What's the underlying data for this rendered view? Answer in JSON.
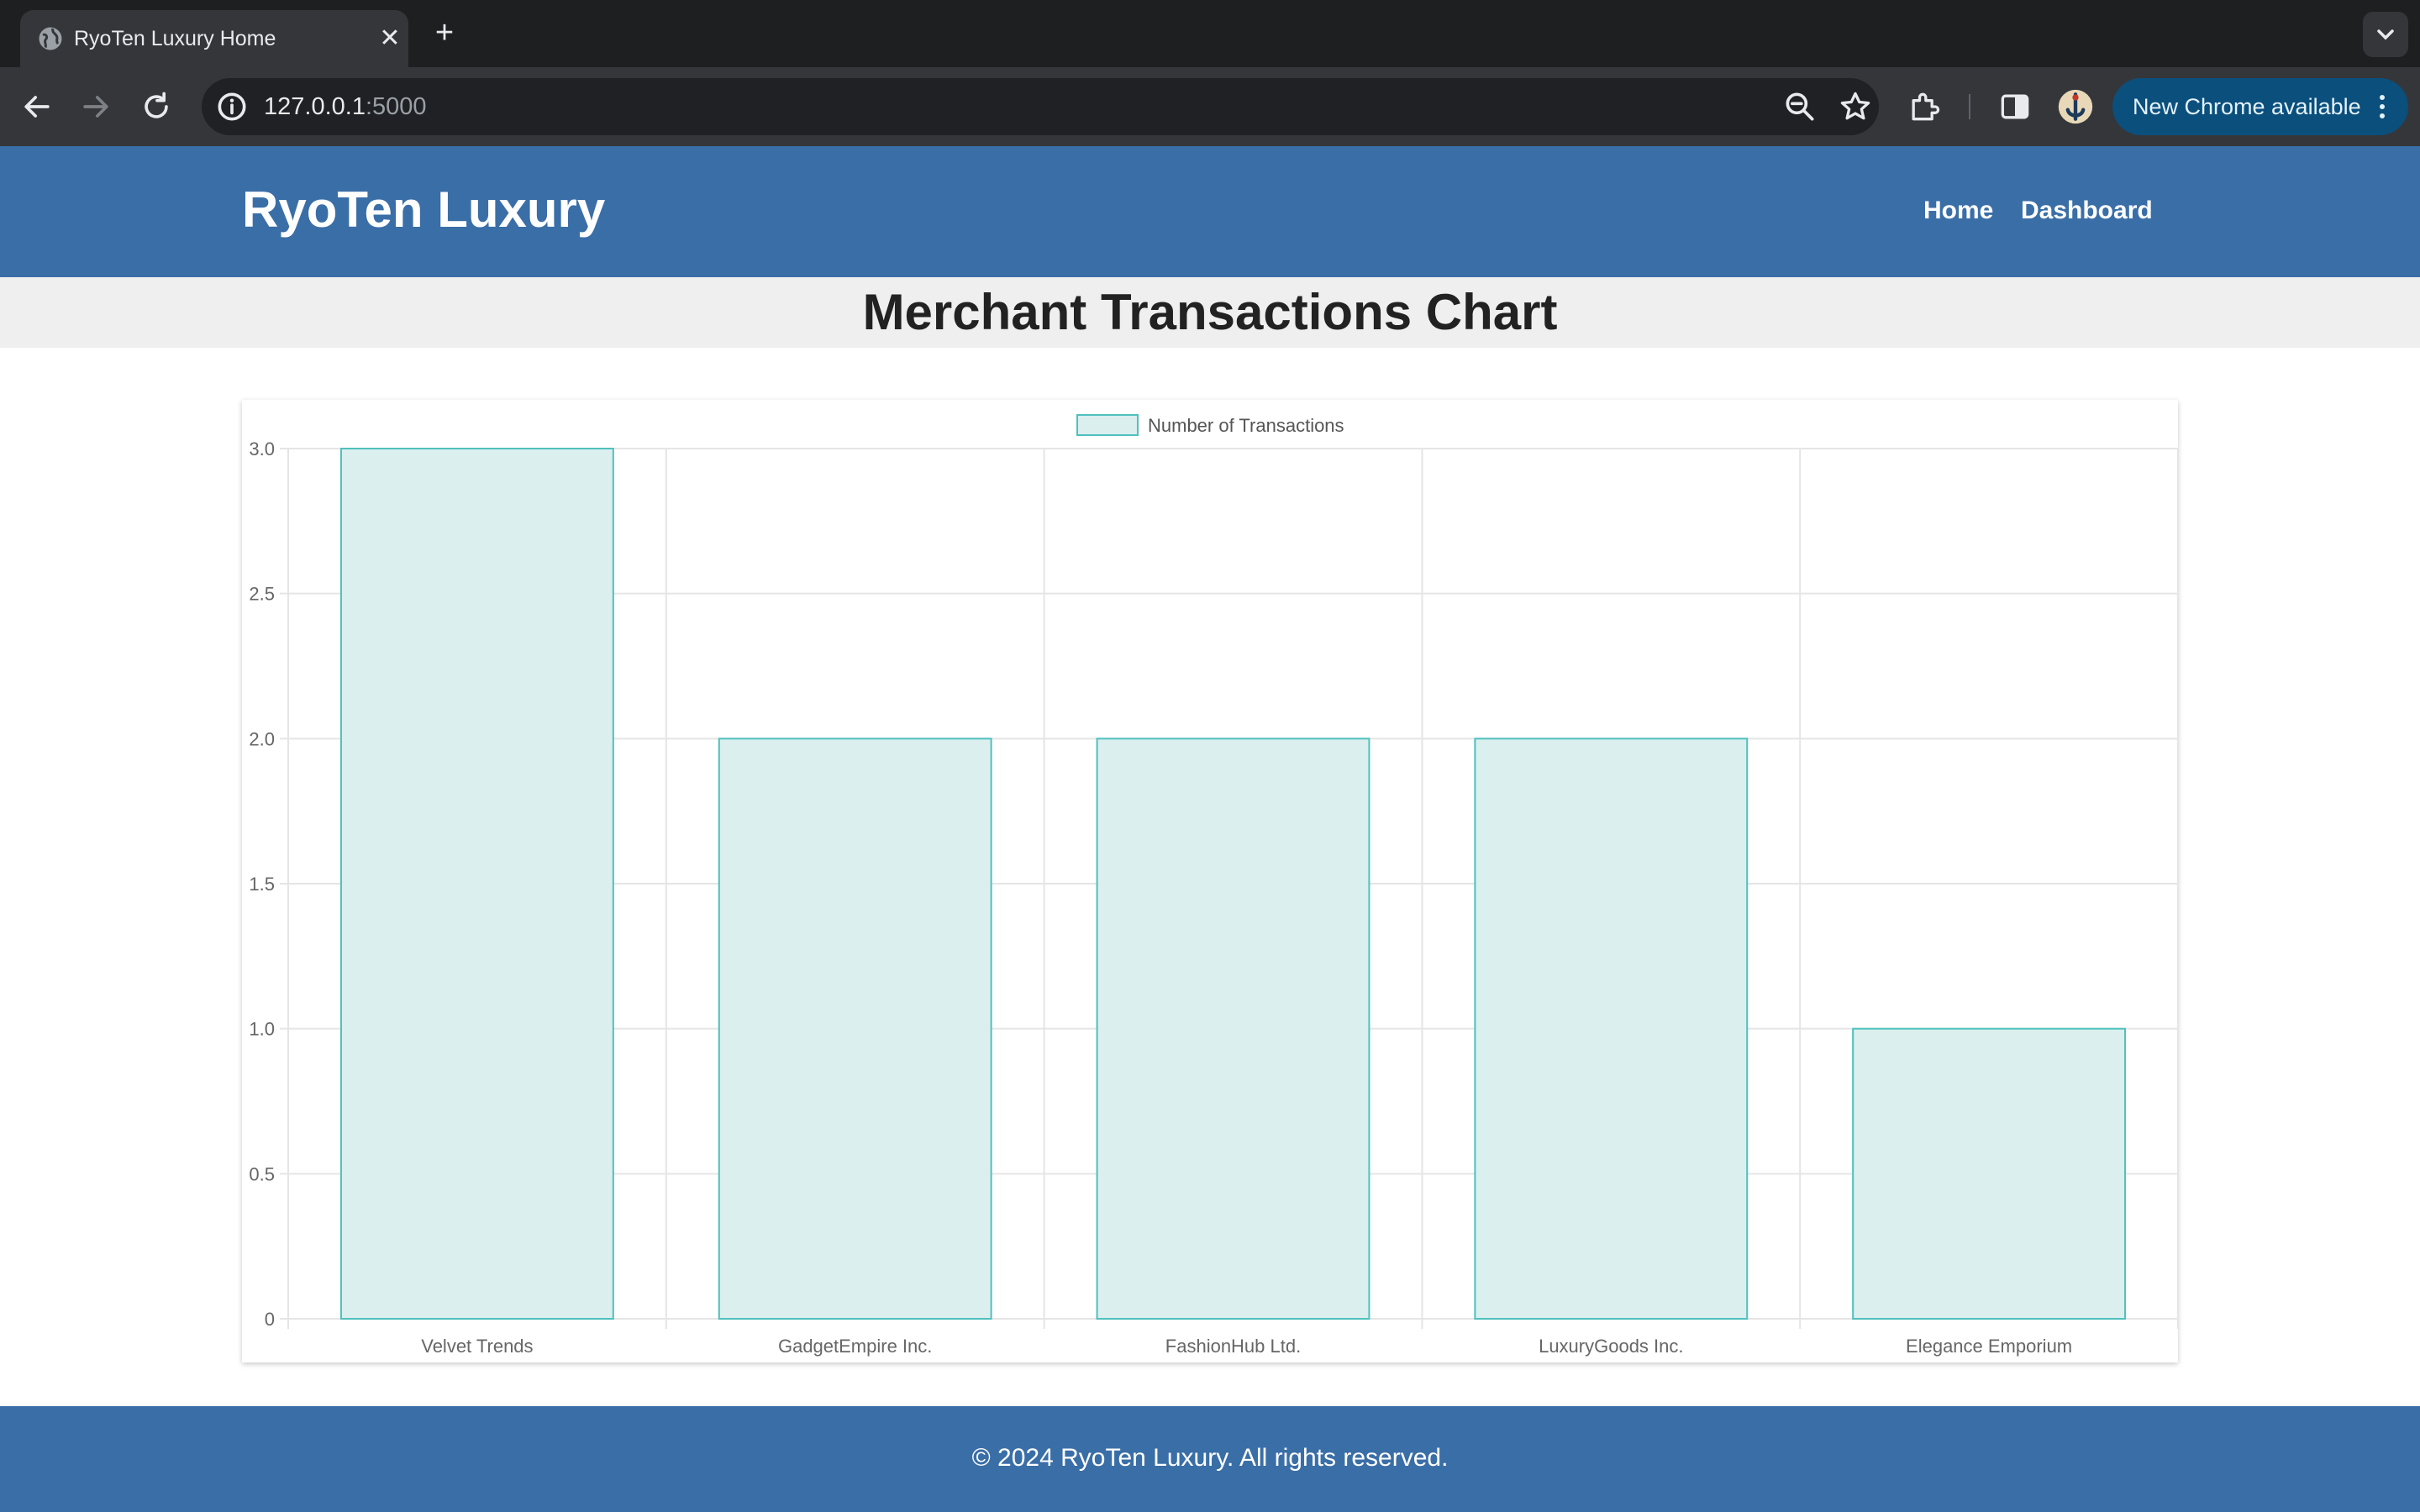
{
  "browser": {
    "tab_title": "RyoTen Luxury Home",
    "url_host": "127.0.0.1",
    "url_port": ":5000",
    "update_label": "New Chrome available",
    "icons": [
      "globe-icon",
      "close-icon",
      "plus-icon",
      "chevron-down-icon",
      "back-arrow-icon",
      "forward-arrow-icon",
      "reload-icon",
      "info-icon",
      "zoom-out-icon",
      "star-icon",
      "extensions-icon",
      "side-panel-icon",
      "profile-avatar",
      "kebab-menu-icon"
    ]
  },
  "header": {
    "brand": "RyoTen Luxury",
    "nav": [
      {
        "label": "Home"
      },
      {
        "label": "Dashboard"
      }
    ]
  },
  "main": {
    "title": "Merchant Transactions Chart"
  },
  "chart_data": {
    "type": "bar",
    "categories": [
      "Velvet Trends",
      "GadgetEmpire Inc.",
      "FashionHub Ltd.",
      "LuxuryGoods Inc.",
      "Elegance Emporium"
    ],
    "series": [
      {
        "name": "Number of Transactions",
        "values": [
          3,
          2,
          2,
          2,
          1
        ]
      }
    ],
    "ylim": [
      0,
      3
    ],
    "yticks": [
      "0",
      "0.5",
      "1.0",
      "1.5",
      "2.0",
      "2.5",
      "3.0"
    ],
    "grid": true,
    "legend": "top-center",
    "colors": {
      "bar_fill": "#daefee",
      "bar_border": "#4fc0bd",
      "grid": "#e5e5e5"
    }
  },
  "footer": {
    "text": "© 2024 RyoTen Luxury. All rights reserved."
  }
}
